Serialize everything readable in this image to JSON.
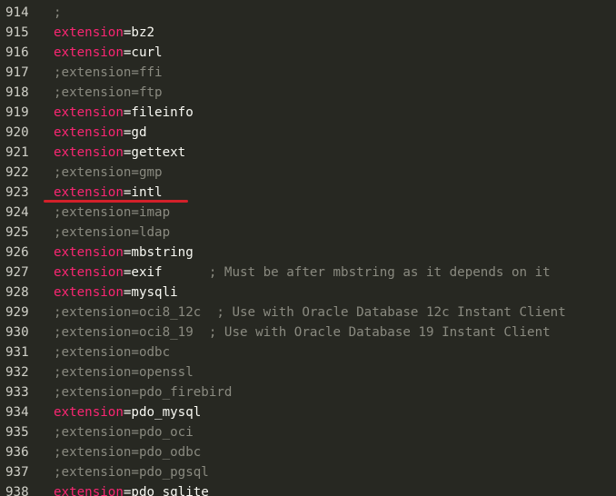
{
  "editor": {
    "lines": [
      {
        "num": "914",
        "type": "comment",
        "text": ";"
      },
      {
        "num": "915",
        "type": "active",
        "key": "extension",
        "value": "bz2"
      },
      {
        "num": "916",
        "type": "active",
        "key": "extension",
        "value": "curl"
      },
      {
        "num": "917",
        "type": "comment",
        "text": ";extension=ffi"
      },
      {
        "num": "918",
        "type": "comment",
        "text": ";extension=ftp"
      },
      {
        "num": "919",
        "type": "active",
        "key": "extension",
        "value": "fileinfo"
      },
      {
        "num": "920",
        "type": "active",
        "key": "extension",
        "value": "gd"
      },
      {
        "num": "921",
        "type": "active",
        "key": "extension",
        "value": "gettext"
      },
      {
        "num": "922",
        "type": "comment",
        "text": ";extension=gmp"
      },
      {
        "num": "923",
        "type": "active",
        "key": "extension",
        "value": "intl",
        "highlighted": true
      },
      {
        "num": "924",
        "type": "comment",
        "text": ";extension=imap"
      },
      {
        "num": "925",
        "type": "comment",
        "text": ";extension=ldap"
      },
      {
        "num": "926",
        "type": "active",
        "key": "extension",
        "value": "mbstring"
      },
      {
        "num": "927",
        "type": "active",
        "key": "extension",
        "value": "exif      ",
        "comment": "; Must be after mbstring as it depends on it"
      },
      {
        "num": "928",
        "type": "active",
        "key": "extension",
        "value": "mysqli"
      },
      {
        "num": "929",
        "type": "comment",
        "text": ";extension=oci8_12c  ; Use with Oracle Database 12c Instant Client"
      },
      {
        "num": "930",
        "type": "comment",
        "text": ";extension=oci8_19  ; Use with Oracle Database 19 Instant Client"
      },
      {
        "num": "931",
        "type": "comment",
        "text": ";extension=odbc"
      },
      {
        "num": "932",
        "type": "comment",
        "text": ";extension=openssl"
      },
      {
        "num": "933",
        "type": "comment",
        "text": ";extension=pdo_firebird"
      },
      {
        "num": "934",
        "type": "active",
        "key": "extension",
        "value": "pdo_mysql"
      },
      {
        "num": "935",
        "type": "comment",
        "text": ";extension=pdo_oci"
      },
      {
        "num": "936",
        "type": "comment",
        "text": ";extension=pdo_odbc"
      },
      {
        "num": "937",
        "type": "comment",
        "text": ";extension=pdo_pgsql"
      },
      {
        "num": "938",
        "type": "active",
        "key": "extension",
        "value": "pdo_sqlite"
      }
    ]
  },
  "colors": {
    "background": "#272822",
    "keyword": "#f92672",
    "text": "#f8f8f2",
    "comment": "#8a8a80",
    "annotation": "#d4202a"
  }
}
